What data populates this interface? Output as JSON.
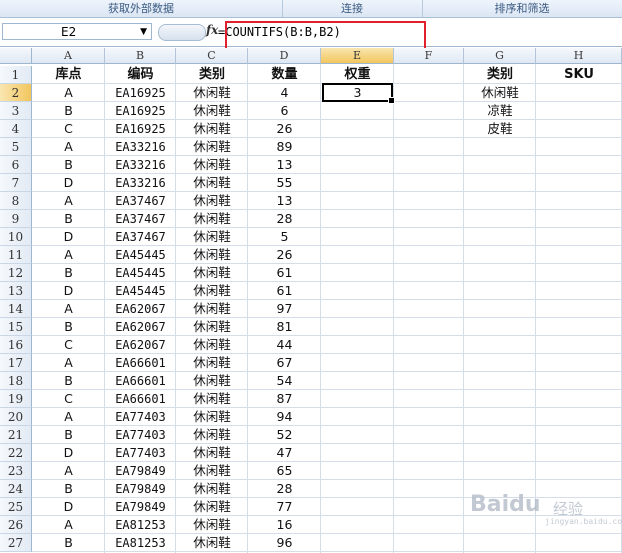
{
  "ribbon": {
    "groups": [
      "获取外部数据",
      "连接",
      "排序和筛选"
    ]
  },
  "formula_bar": {
    "name_box": "E2",
    "fx_label": "fx",
    "formula": "=COUNTIFS(B:B,B2)"
  },
  "columns": [
    "A",
    "B",
    "C",
    "D",
    "E",
    "F",
    "G",
    "H"
  ],
  "selected": {
    "column": "E",
    "row": 2
  },
  "headers": {
    "A": "库点",
    "B": "编码",
    "C": "类别",
    "D": "数量",
    "E": "权重",
    "G": "类别",
    "H": "SKU"
  },
  "rows": [
    {
      "n": "1"
    },
    {
      "n": "2",
      "a": "A",
      "b": "EA16925",
      "c": "休闲鞋",
      "d": "4",
      "e": "3",
      "g": "休闲鞋"
    },
    {
      "n": "3",
      "a": "B",
      "b": "EA16925",
      "c": "休闲鞋",
      "d": "6",
      "g": "凉鞋"
    },
    {
      "n": "4",
      "a": "C",
      "b": "EA16925",
      "c": "休闲鞋",
      "d": "26",
      "g": "皮鞋"
    },
    {
      "n": "5",
      "a": "A",
      "b": "EA33216",
      "c": "休闲鞋",
      "d": "89"
    },
    {
      "n": "6",
      "a": "B",
      "b": "EA33216",
      "c": "休闲鞋",
      "d": "13"
    },
    {
      "n": "7",
      "a": "D",
      "b": "EA33216",
      "c": "休闲鞋",
      "d": "55"
    },
    {
      "n": "8",
      "a": "A",
      "b": "EA37467",
      "c": "休闲鞋",
      "d": "13"
    },
    {
      "n": "9",
      "a": "B",
      "b": "EA37467",
      "c": "休闲鞋",
      "d": "28"
    },
    {
      "n": "10",
      "a": "D",
      "b": "EA37467",
      "c": "休闲鞋",
      "d": "5"
    },
    {
      "n": "11",
      "a": "A",
      "b": "EA45445",
      "c": "休闲鞋",
      "d": "26"
    },
    {
      "n": "12",
      "a": "B",
      "b": "EA45445",
      "c": "休闲鞋",
      "d": "61"
    },
    {
      "n": "13",
      "a": "D",
      "b": "EA45445",
      "c": "休闲鞋",
      "d": "61"
    },
    {
      "n": "14",
      "a": "A",
      "b": "EA62067",
      "c": "休闲鞋",
      "d": "97"
    },
    {
      "n": "15",
      "a": "B",
      "b": "EA62067",
      "c": "休闲鞋",
      "d": "81"
    },
    {
      "n": "16",
      "a": "C",
      "b": "EA62067",
      "c": "休闲鞋",
      "d": "44"
    },
    {
      "n": "17",
      "a": "A",
      "b": "EA66601",
      "c": "休闲鞋",
      "d": "67"
    },
    {
      "n": "18",
      "a": "B",
      "b": "EA66601",
      "c": "休闲鞋",
      "d": "54"
    },
    {
      "n": "19",
      "a": "C",
      "b": "EA66601",
      "c": "休闲鞋",
      "d": "87"
    },
    {
      "n": "20",
      "a": "A",
      "b": "EA77403",
      "c": "休闲鞋",
      "d": "94"
    },
    {
      "n": "21",
      "a": "B",
      "b": "EA77403",
      "c": "休闲鞋",
      "d": "52"
    },
    {
      "n": "22",
      "a": "D",
      "b": "EA77403",
      "c": "休闲鞋",
      "d": "47"
    },
    {
      "n": "23",
      "a": "A",
      "b": "EA79849",
      "c": "休闲鞋",
      "d": "65"
    },
    {
      "n": "24",
      "a": "B",
      "b": "EA79849",
      "c": "休闲鞋",
      "d": "28"
    },
    {
      "n": "25",
      "a": "D",
      "b": "EA79849",
      "c": "休闲鞋",
      "d": "77"
    },
    {
      "n": "26",
      "a": "A",
      "b": "EA81253",
      "c": "休闲鞋",
      "d": "16"
    },
    {
      "n": "27",
      "a": "B",
      "b": "EA81253",
      "c": "休闲鞋",
      "d": "96"
    }
  ],
  "watermark": {
    "brand": "Baidu",
    "brand_cn": "经验",
    "url": "jingyan.baidu.com"
  },
  "colors": {
    "formula_highlight": "#e0202c",
    "selection_header": "#f2c65e"
  }
}
